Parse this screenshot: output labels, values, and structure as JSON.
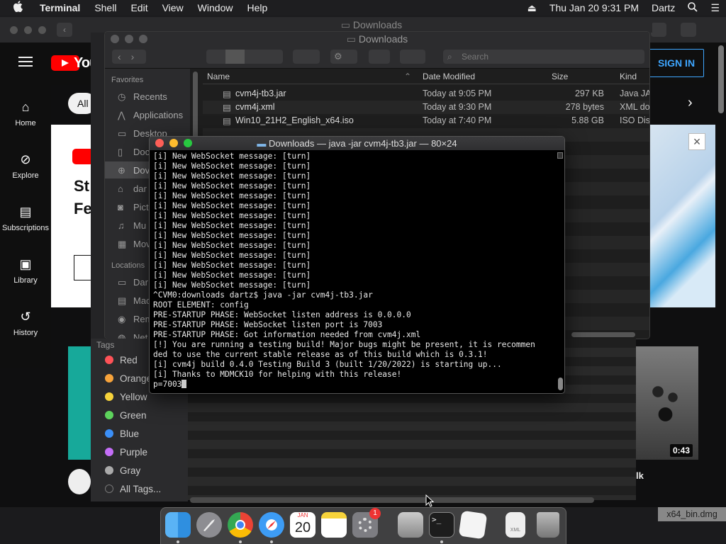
{
  "menubar": {
    "apple": "",
    "app": "Terminal",
    "items": [
      "Shell",
      "Edit",
      "View",
      "Window",
      "Help"
    ],
    "clock": "Thu Jan 20  9:31 PM",
    "user": "Dartz"
  },
  "bg_finder": {
    "title": "Downloads"
  },
  "youtube": {
    "logo_text": "You",
    "sign_in": "SIGN IN",
    "nav": [
      "Home",
      "Explore",
      "Subscriptions",
      "Library",
      "History"
    ],
    "chip": "All",
    "video_duration": "0:43",
    "fragments": {
      "st": "St",
      "fe": "Fe",
      "lk": "lk"
    }
  },
  "finder": {
    "title": "Downloads",
    "search_placeholder": "Search",
    "sidebar": {
      "favorites_header": "Favorites",
      "favorites": [
        "Recents",
        "Applications",
        "Desktop",
        "Doc",
        "Dov",
        "dar",
        "Pict",
        "Mu",
        "Mov"
      ],
      "locations_header": "Locations",
      "locations": [
        "Dar",
        "Mac",
        "Rem",
        "Net"
      ]
    },
    "columns": {
      "name": "Name",
      "date": "Date Modified",
      "size": "Size",
      "kind": "Kind"
    },
    "files": [
      {
        "name": "cvm4j-tb3.jar",
        "date": "Today at 9:05 PM",
        "size": "297 KB",
        "kind": "Java JA"
      },
      {
        "name": "cvm4j.xml",
        "date": "Today at 9:30 PM",
        "size": "278 bytes",
        "kind": "XML do"
      },
      {
        "name": "Win10_21H2_English_x64.iso",
        "date": "Today at 7:40 PM",
        "size": "5.88 GB",
        "kind": "ISO Disk"
      }
    ]
  },
  "tags": {
    "header": "Tags",
    "items": [
      {
        "label": "Red",
        "color": "#ff5257"
      },
      {
        "label": "Orange",
        "color": "#f7a33b"
      },
      {
        "label": "Yellow",
        "color": "#f7d33b"
      },
      {
        "label": "Green",
        "color": "#5dd35c"
      },
      {
        "label": "Blue",
        "color": "#3b8ff7"
      },
      {
        "label": "Purple",
        "color": "#c46ef7"
      },
      {
        "label": "Gray",
        "color": "#aaaaaa"
      },
      {
        "label": "All Tags...",
        "color": ""
      }
    ]
  },
  "terminal": {
    "title": "Downloads — java -jar cvm4j-tb3.jar — 80×24",
    "lines": [
      "[i] New WebSocket message: [turn]",
      "[i] New WebSocket message: [turn]",
      "[i] New WebSocket message: [turn]",
      "[i] New WebSocket message: [turn]",
      "[i] New WebSocket message: [turn]",
      "[i] New WebSocket message: [turn]",
      "[i] New WebSocket message: [turn]",
      "[i] New WebSocket message: [turn]",
      "[i] New WebSocket message: [turn]",
      "[i] New WebSocket message: [turn]",
      "[i] New WebSocket message: [turn]",
      "[i] New WebSocket message: [turn]",
      "[i] New WebSocket message: [turn]",
      "[i] New WebSocket message: [turn]",
      "^CVM0:downloads dartz$ java -jar cvm4j-tb3.jar",
      "ROOT ELEMENT: config",
      "PRE-STARTUP PHASE: WebSocket listen address is 0.0.0.0",
      "PRE-STARTUP PHASE: WebSocket listen port is 7003",
      "PRE-STARTUP PHASE: Got information needed from cvm4j.xml",
      "[!] You are running a testing build! Major bugs might be present, it is recommen",
      "ded to use the current stable release as of this build which is 0.3.1!",
      "[i] cvm4j build 0.4.0 Testing Build 3 (built 1/20/2022) is starting up...",
      "[i] Thanks to MDMCK10 for helping with this release!",
      "p=7003"
    ]
  },
  "dock": {
    "apps": [
      "Finder",
      "Launchpad",
      "Chrome",
      "Safari",
      "Calendar",
      "Notes",
      "System Preferences",
      "Disk Utility",
      "Terminal",
      "TextEdit",
      "Document",
      "Trash"
    ],
    "calendar_month": "JAN",
    "calendar_day": "20",
    "sysprefs_badge": "1",
    "terminal_glyph": ">_",
    "doc_label": "XML"
  },
  "desktop_file": "x64_bin.dmg"
}
